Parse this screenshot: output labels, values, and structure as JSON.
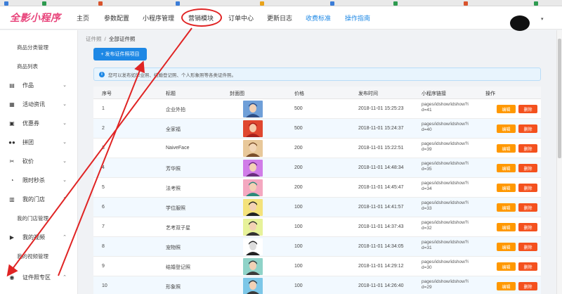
{
  "header": {
    "logo": "全影小程序",
    "nav": [
      {
        "label": "主页"
      },
      {
        "label": "参数配置"
      },
      {
        "label": "小程序管理"
      },
      {
        "label": "营销模块"
      },
      {
        "label": "订单中心"
      },
      {
        "label": "更新日志"
      },
      {
        "label": "收费标准"
      },
      {
        "label": "操作指南"
      }
    ],
    "highlighted_nav": "营销模块"
  },
  "sidebar": {
    "items": [
      {
        "label": "商品分类管理",
        "kind": "sub"
      },
      {
        "label": "商品列表",
        "kind": "sub"
      },
      {
        "label": "作品",
        "kind": "group",
        "icon": "folder-icon"
      },
      {
        "label": "活动资讯",
        "kind": "group",
        "icon": "news-icon"
      },
      {
        "label": "优惠券",
        "kind": "group",
        "icon": "coupon-icon"
      },
      {
        "label": "拼团",
        "kind": "group",
        "icon": "group-icon"
      },
      {
        "label": "砍价",
        "kind": "group",
        "icon": "scissors-icon"
      },
      {
        "label": "限时秒杀",
        "kind": "group",
        "icon": "clock-icon"
      },
      {
        "label": "我的门店",
        "kind": "group",
        "icon": "store-icon"
      },
      {
        "label": "我的门店管理",
        "kind": "sub"
      },
      {
        "label": "我的视频",
        "kind": "group",
        "icon": "video-icon"
      },
      {
        "label": "我的视频管理",
        "kind": "sub"
      },
      {
        "label": "证件照专区",
        "kind": "group",
        "icon": "id-photo-icon"
      }
    ]
  },
  "breadcrumb": {
    "root": "证件照",
    "sep": "/",
    "current": "全部证件照"
  },
  "add_button": {
    "label": "+ 发布证件照项目"
  },
  "notice": {
    "text": "您可以发布如毕业照、结婚登记照、个人形象照等各类证件照。"
  },
  "table": {
    "headers": [
      "序号",
      "标题",
      "封面图",
      "价格",
      "发布时间",
      "小程序链接",
      "操作"
    ],
    "edit_label": "编辑",
    "delete_label": "删除",
    "rows": [
      {
        "id": "1",
        "title": "企业外拍",
        "price": "500",
        "time": "2018-11-01 15:25:23",
        "link": "pages/idshow/idshow?id=41",
        "thumb": "group-photo"
      },
      {
        "id": "2",
        "title": "全家福",
        "price": "500",
        "time": "2018-11-01 15:24:37",
        "link": "pages/idshow/idshow?id=40",
        "thumb": "family"
      },
      {
        "id": "3",
        "title": "NaiveFace",
        "price": "200",
        "time": "2018-11-01 15:22:51",
        "link": "pages/idshow/idshow?id=39",
        "thumb": "face-tan"
      },
      {
        "id": "4",
        "title": "芳华照",
        "price": "200",
        "time": "2018-11-01 14:48:34",
        "link": "pages/idshow/idshow?id=35",
        "thumb": "face-purple"
      },
      {
        "id": "5",
        "title": "法考照",
        "price": "200",
        "time": "2018-11-01 14:45:47",
        "link": "pages/idshow/idshow?id=34",
        "thumb": "face-teal"
      },
      {
        "id": "6",
        "title": "学位服照",
        "price": "100",
        "time": "2018-11-01 14:41:57",
        "link": "pages/idshow/idshow?id=33",
        "thumb": "graduate"
      },
      {
        "id": "7",
        "title": "艺考双子星",
        "price": "100",
        "time": "2018-11-01 14:37:43",
        "link": "pages/idshow/idshow?id=32",
        "thumb": "duo-graduate"
      },
      {
        "id": "8",
        "title": "宠物照",
        "price": "100",
        "time": "2018-11-01 14:34:05",
        "link": "pages/idshow/idshow?id=31",
        "thumb": "pet"
      },
      {
        "id": "9",
        "title": "结婚登记照",
        "price": "100",
        "time": "2018-11-01 14:29:12",
        "link": "pages/idshow/idshow?id=30",
        "thumb": "couple"
      },
      {
        "id": "10",
        "title": "形象照",
        "price": "100",
        "time": "2018-11-01 14:26:40",
        "link": "pages/idshow/idshow?id=29",
        "thumb": "portrait"
      }
    ]
  },
  "colors": {
    "primary": "#1e88e5",
    "edit": "#ff9800",
    "delete": "#f4511e",
    "logo": "#e8437a",
    "annotation": "#e02424"
  }
}
